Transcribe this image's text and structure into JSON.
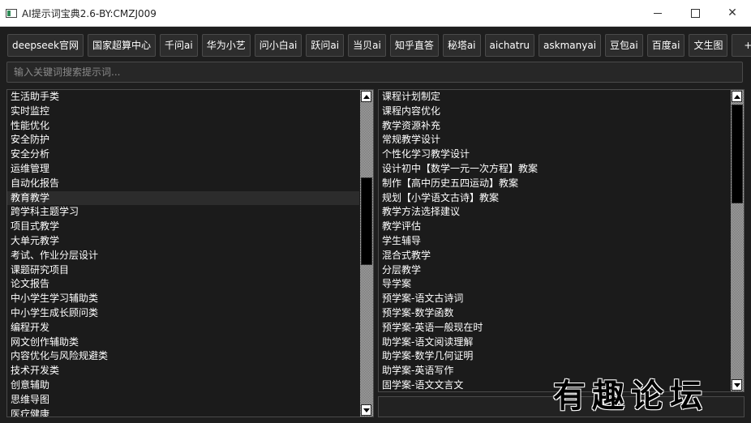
{
  "window": {
    "title": "AI提示词宝典2.6-BY:CMZJ009"
  },
  "toolbar": {
    "buttons": [
      {
        "label": "deepseek官网"
      },
      {
        "label": "国家超算中心"
      },
      {
        "label": "千问ai"
      },
      {
        "label": "华为小艺"
      },
      {
        "label": "问小白ai"
      },
      {
        "label": "跃问ai"
      },
      {
        "label": "当贝ai"
      },
      {
        "label": "知乎直答"
      },
      {
        "label": "秘塔ai"
      },
      {
        "label": "aichatru"
      },
      {
        "label": "askmanyai"
      },
      {
        "label": "豆包ai"
      },
      {
        "label": "百度ai"
      },
      {
        "label": "文生图"
      }
    ],
    "add_label": "+"
  },
  "search": {
    "placeholder": "输入关键词搜索提示词..."
  },
  "categories": {
    "selected_index": 7,
    "items": [
      "生活助手类",
      "实时监控",
      "性能优化",
      "安全防护",
      "安全分析",
      "运维管理",
      "自动化报告",
      "教育教学",
      "跨学科主题学习",
      "项目式教学",
      "大单元教学",
      "考试、作业分层设计",
      "课题研究项目",
      "论文报告",
      "中小学生学习辅助类",
      "中小学生成长顾问类",
      "编程开发",
      "网文创作辅助类",
      "内容优化与风险规避类",
      "技术开发类",
      "创意辅助",
      "思维导图",
      "医疗健康"
    ]
  },
  "prompts": {
    "items": [
      "课程计划制定",
      "课程内容优化",
      "教学资源补充",
      "常规教学设计",
      "个性化学习教学设计",
      "设计初中【数学一元一次方程】教案",
      "制作【高中历史五四运动】教案",
      "规划【小学语文古诗】教案",
      "教学方法选择建议",
      "教学评估",
      "学生辅导",
      "混合式教学",
      "分层教学",
      "导学案",
      "预学案-语文古诗词",
      "预学案-数学函数",
      "预学案-英语一般现在时",
      "助学案-语文阅读理解",
      "助学案-数学几何证明",
      "助学案-英语写作",
      "固学案-语文文言文"
    ]
  },
  "watermark": {
    "text": "有趣论坛"
  }
}
